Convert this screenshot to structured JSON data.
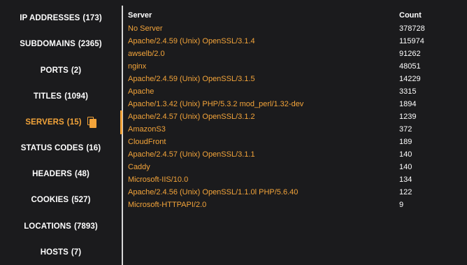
{
  "sidebar": {
    "items": [
      {
        "label": "IP ADDRESSES",
        "count": "(173)"
      },
      {
        "label": "SUBDOMAINS",
        "count": "(2365)"
      },
      {
        "label": "PORTS",
        "count": "(2)"
      },
      {
        "label": "TITLES",
        "count": "(1094)"
      },
      {
        "label": "SERVERS",
        "count": "(15)",
        "active": true,
        "icon": "copy-icon"
      },
      {
        "label": "STATUS CODES",
        "count": "(16)"
      },
      {
        "label": "HEADERS",
        "count": "(48)"
      },
      {
        "label": "COOKIES",
        "count": "(527)"
      },
      {
        "label": "LOCATIONS",
        "count": "(7893)"
      },
      {
        "label": "HOSTS",
        "count": "(7)"
      }
    ]
  },
  "table": {
    "headers": {
      "server": "Server",
      "count": "Count"
    },
    "rows": [
      {
        "server": "No Server",
        "count": "378728"
      },
      {
        "server": "Apache/2.4.59 (Unix) OpenSSL/3.1.4",
        "count": "115974"
      },
      {
        "server": "awselb/2.0",
        "count": "91262"
      },
      {
        "server": "nginx",
        "count": "48051"
      },
      {
        "server": "Apache/2.4.59 (Unix) OpenSSL/3.1.5",
        "count": "14229"
      },
      {
        "server": "Apache",
        "count": "3315"
      },
      {
        "server": "Apache/1.3.42 (Unix) PHP/5.3.2 mod_perl/1.32-dev",
        "count": "1894"
      },
      {
        "server": "Apache/2.4.57 (Unix) OpenSSL/3.1.2",
        "count": "1239"
      },
      {
        "server": "AmazonS3",
        "count": "372"
      },
      {
        "server": "CloudFront",
        "count": "189"
      },
      {
        "server": "Apache/2.4.57 (Unix) OpenSSL/3.1.1",
        "count": "140"
      },
      {
        "server": "Caddy",
        "count": "140"
      },
      {
        "server": "Microsoft-IIS/10.0",
        "count": "134"
      },
      {
        "server": "Apache/2.4.56 (Unix) OpenSSL/1.1.0l PHP/5.6.40",
        "count": "122"
      },
      {
        "server": "Microsoft-HTTPAPI/2.0",
        "count": "9"
      }
    ]
  },
  "colors": {
    "background": "#1b1b1d",
    "accent": "#f3a43a",
    "text": "#ffffff",
    "divider": "#d8d8d8"
  }
}
